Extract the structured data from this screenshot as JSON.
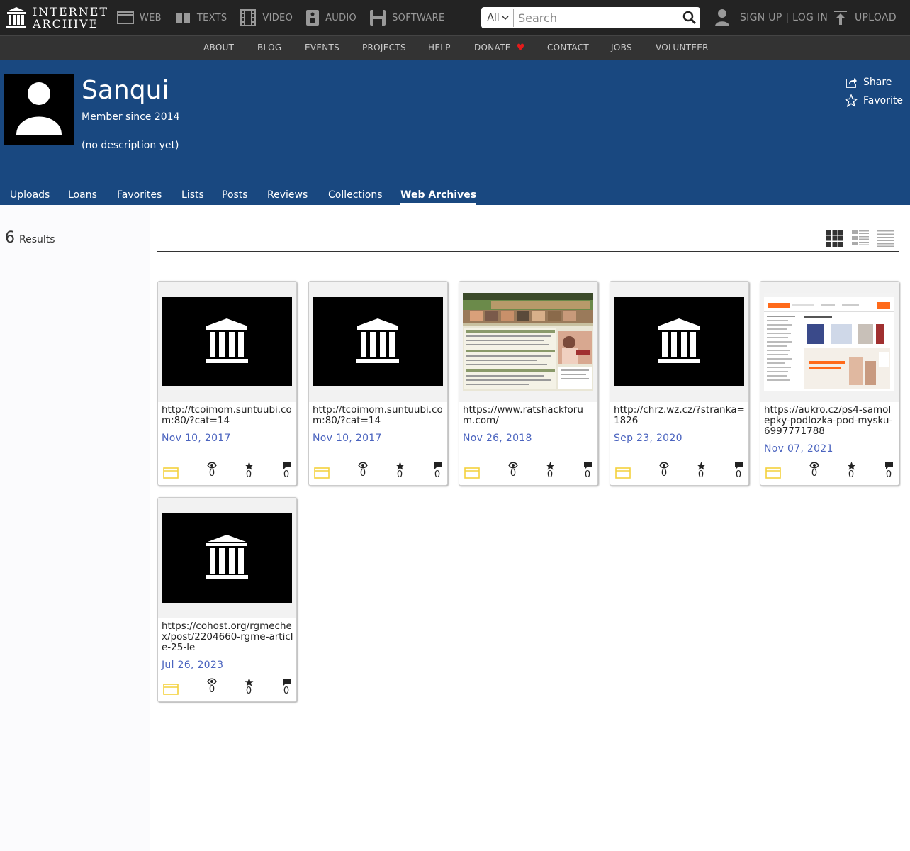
{
  "topbar": {
    "logo_line1": "INTERNET",
    "logo_line2": "ARCHIVE",
    "media": [
      {
        "label": "WEB",
        "icon": "web-icon"
      },
      {
        "label": "TEXTS",
        "icon": "texts-icon"
      },
      {
        "label": "VIDEO",
        "icon": "video-icon"
      },
      {
        "label": "AUDIO",
        "icon": "audio-icon"
      },
      {
        "label": "SOFTWARE",
        "icon": "software-icon"
      }
    ],
    "search": {
      "scope": "All",
      "placeholder": "Search"
    },
    "signup": "SIGN UP | LOG IN",
    "upload": "UPLOAD"
  },
  "subnav": [
    "ABOUT",
    "BLOG",
    "EVENTS",
    "PROJECTS",
    "HELP",
    "DONATE",
    "CONTACT",
    "JOBS",
    "VOLUNTEER"
  ],
  "colors": {
    "header_bg": "#232323",
    "hero_bg": "#194880",
    "accent_link": "#4b64bf",
    "donate_heart": "#e41b1b",
    "web_type_icon": "#f3d13c"
  },
  "profile": {
    "name": "Sanqui",
    "since": "Member since 2014",
    "description": "(no description yet)",
    "share": "Share",
    "favorite": "Favorite"
  },
  "tabs": [
    {
      "label": "Uploads",
      "active": false
    },
    {
      "label": "Loans",
      "active": false
    },
    {
      "label": "Favorites",
      "active": false
    },
    {
      "label": "Lists",
      "active": false
    },
    {
      "label": "Posts",
      "active": false
    },
    {
      "label": "Reviews",
      "active": false
    },
    {
      "label": "Collections",
      "active": false
    },
    {
      "label": "Web Archives",
      "active": true
    }
  ],
  "results": {
    "count": "6",
    "label": "Results"
  },
  "items": [
    {
      "title": "http://tcoimom.suntuubi.com:80/?cat=14",
      "date": "Nov 10, 2017",
      "thumb": "archive-logo",
      "views": "0",
      "favorites": "0",
      "reviews": "0"
    },
    {
      "title": "http://tcoimom.suntuubi.com:80/?cat=14",
      "date": "Nov 10, 2017",
      "thumb": "archive-logo",
      "views": "0",
      "favorites": "0",
      "reviews": "0"
    },
    {
      "title": "https://www.ratshackforum.com/",
      "date": "Nov 26, 2018",
      "thumb": "forum-screenshot",
      "views": "0",
      "favorites": "0",
      "reviews": "0"
    },
    {
      "title": "http://chrz.wz.cz/?stranka=1826",
      "date": "Sep 23, 2020",
      "thumb": "archive-logo",
      "views": "0",
      "favorites": "0",
      "reviews": "0"
    },
    {
      "title": "https://aukro.cz/ps4-samolepky-podlozka-pod-mysku-6997771788",
      "date": "Nov 07, 2021",
      "thumb": "shop-screenshot",
      "views": "0",
      "favorites": "0",
      "reviews": "0"
    },
    {
      "title": "https://cohost.org/rgmechex/post/2204660-rgme-article-25-le",
      "date": "Jul 26, 2023",
      "thumb": "archive-logo",
      "views": "0",
      "favorites": "0",
      "reviews": "0"
    }
  ]
}
